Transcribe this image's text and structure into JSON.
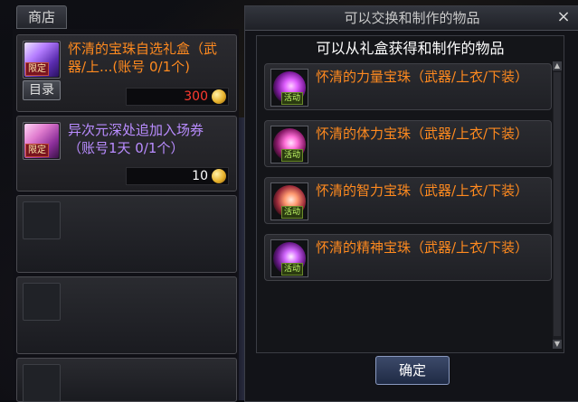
{
  "shop": {
    "tab_label": "商店",
    "items": [
      {
        "name": "怀清的宝珠自选礼盒（武器/上...(账号 0/1个)",
        "badge": "限定",
        "catalog_label": "目录",
        "price": "300",
        "icon": "gift-box-icon",
        "price_color": "#ff3b30"
      },
      {
        "name": "异次元深处追加入场券 （账号1天 0/1个）",
        "badge": "限定",
        "price": "10",
        "icon": "ticket-icon",
        "price_color": "#ffffff"
      }
    ]
  },
  "dialog": {
    "title": "可以交换和制作的物品",
    "close_icon": "×",
    "subtitle": "可以从礼盒获得和制作的物品",
    "items": [
      {
        "name": "怀清的力量宝珠（武器/上衣/下装）",
        "badge": "活动",
        "icon": "orb-icon"
      },
      {
        "name": "怀清的体力宝珠（武器/上衣/下装）",
        "badge": "活动",
        "icon": "orb-icon"
      },
      {
        "name": "怀清的智力宝珠（武器/上衣/下装）",
        "badge": "活动",
        "icon": "orb-icon"
      },
      {
        "name": "怀清的精神宝珠（武器/上衣/下装）",
        "badge": "活动",
        "icon": "orb-icon"
      }
    ],
    "confirm_label": "确定"
  },
  "colors": {
    "item_name_orange": "#ff8a1f",
    "item_name_purple": "#b98cff",
    "price_red": "#ff3b30"
  }
}
